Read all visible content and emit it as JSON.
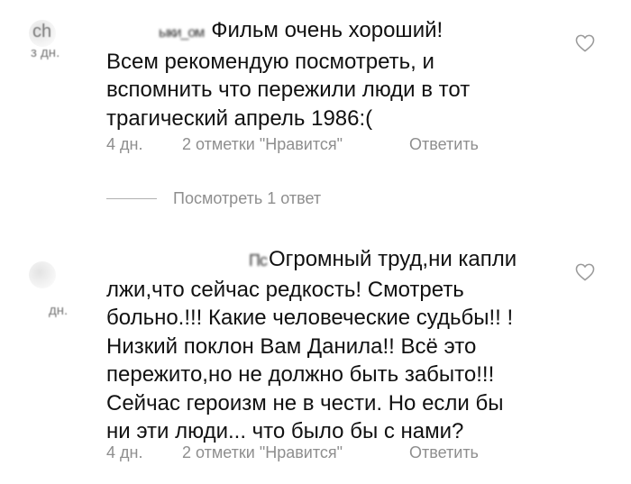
{
  "comments": [
    {
      "avatar_initials": "ch",
      "username": "ыки_ом",
      "time_label": "з дн.",
      "text_lines": [
        "Фильм очень хороший!",
        "Всем рекомендую посмотреть, и",
        "вспомнить что пережили люди в тот",
        "трагический апрель 1986:("
      ],
      "meta": {
        "time": "4 дн.",
        "likes": "2 отметки \"Нравится\"",
        "reply": "Ответить"
      },
      "view_replies": "Посмотреть 1 ответ"
    },
    {
      "avatar_initials": "",
      "username": "Пс",
      "time_label": "дн.",
      "text_lines": [
        "Огромный труд,ни капли",
        "лжи,что сейчас редкость! Смотреть",
        "больно.!!! Какие человеческие судьбы!! !",
        "Низкий поклон Вам Данила!! Всё это",
        "пережито,но не должно быть забыто!!!",
        "Сейчас героизм не в чести. Но если бы",
        "ни эти люди... что было бы с нами?"
      ],
      "meta": {
        "time": "4 дн.",
        "likes": "2 отметки \"Нравится\"",
        "reply": "Ответить"
      }
    }
  ],
  "icons": {
    "like": "heart-outline-icon"
  },
  "colors": {
    "text": "#111111",
    "meta": "#8e8e8e",
    "background": "#ffffff"
  }
}
